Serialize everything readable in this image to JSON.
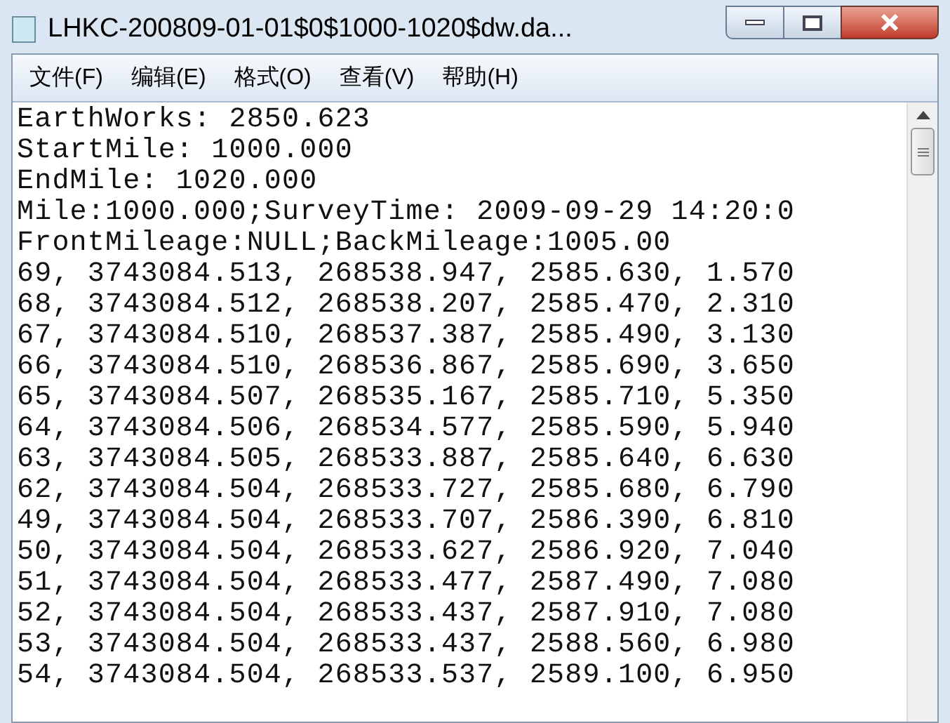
{
  "window": {
    "title": "LHKC-200809-01-01$0$1000-1020$dw.da..."
  },
  "menu": [
    "文件(F)",
    "编辑(E)",
    "格式(O)",
    "查看(V)",
    "帮助(H)"
  ],
  "lines": [
    "EarthWorks: 2850.623",
    "StartMile: 1000.000",
    "EndMile: 1020.000",
    "Mile:1000.000;SurveyTime: 2009-09-29 14:20:0",
    "FrontMileage:NULL;BackMileage:1005.00",
    "69, 3743084.513, 268538.947, 2585.630, 1.570",
    "68, 3743084.512, 268538.207, 2585.470, 2.310",
    "67, 3743084.510, 268537.387, 2585.490, 3.130",
    "66, 3743084.510, 268536.867, 2585.690, 3.650",
    "65, 3743084.507, 268535.167, 2585.710, 5.350",
    "64, 3743084.506, 268534.577, 2585.590, 5.940",
    "63, 3743084.505, 268533.887, 2585.640, 6.630",
    "62, 3743084.504, 268533.727, 2585.680, 6.790",
    "49, 3743084.504, 268533.707, 2586.390, 6.810",
    "50, 3743084.504, 268533.627, 2586.920, 7.040",
    "51, 3743084.504, 268533.477, 2587.490, 7.080",
    "52, 3743084.504, 268533.437, 2587.910, 7.080",
    "53, 3743084.504, 268533.437, 2588.560, 6.980",
    "54, 3743084.504, 268533.537, 2589.100, 6.950"
  ]
}
